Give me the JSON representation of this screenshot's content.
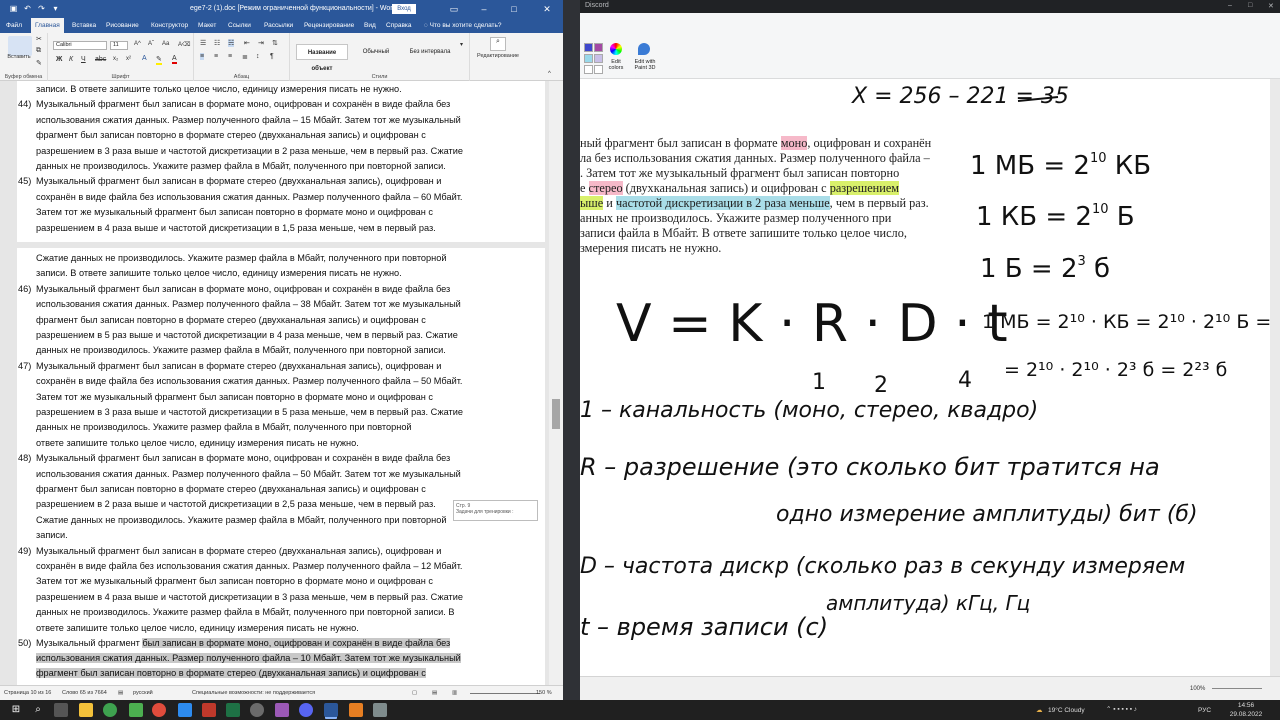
{
  "word": {
    "title": "ege7-2 (1).doc [Режим ограниченной функциональности] - Word",
    "signin": "Вход",
    "tabs": [
      "Файл",
      "Главная",
      "Вставка",
      "Рисование",
      "Конструктор",
      "Макет",
      "Ссылки",
      "Рассылки",
      "Рецензирование",
      "Вид",
      "Справка"
    ],
    "tell_me": "Что вы хотите сделать?",
    "ribbon": {
      "paste": "Вставить",
      "font_name": "Calibri",
      "font_size": "11",
      "clipboard": "Буфер обмена",
      "font": "Шрифт",
      "paragraph": "Абзац",
      "styles": "Стили",
      "editing": "Редактирование",
      "style_items": [
        "Название объект",
        "Обычный",
        "Без интервала"
      ]
    },
    "doc_lines": [
      {
        "n": "",
        "t": "записи. В ответе запишите только целое число, единицу измерения писать не нужно."
      },
      {
        "n": "44)",
        "t": "Музыкальный фрагмент был записан в формате моно, оцифрован и сохранён в виде файла без"
      },
      {
        "n": "",
        "t": "использования сжатия данных. Размер полученного файла – 15 Мбайт. Затем тот же музыкальный"
      },
      {
        "n": "",
        "t": "фрагмент был записан повторно в формате стерео (двухканальная запись) и оцифрован с"
      },
      {
        "n": "",
        "t": "разрешением в 3 раза выше и частотой дискретизации в 2 раза меньше, чем в первый раз. Сжатие"
      },
      {
        "n": "",
        "t": "данных не производилось. Укажите размер файла в Мбайт, полученного при повторной записи."
      },
      {
        "n": "45)",
        "t": "Музыкальный фрагмент был записан в формате стерео (двухканальная запись), оцифрован и"
      },
      {
        "n": "",
        "t": "сохранён в виде файла без использования сжатия данных. Размер полученного файла – 60 Мбайт."
      },
      {
        "n": "",
        "t": "Затем тот же музыкальный фрагмент был записан повторно в формате моно и оцифрован с"
      },
      {
        "n": "",
        "t": "разрешением в 4 раза выше и частотой дискретизации в 1,5 раза меньше, чем в первый раз."
      }
    ],
    "doc_lines2": [
      {
        "n": "",
        "t": "Сжатие данных не производилось. Укажите размер файла в Мбайт, полученного при повторной"
      },
      {
        "n": "",
        "t": "записи. В ответе запишите только целое число, единицу измерения писать не нужно."
      },
      {
        "n": "46)",
        "t": "Музыкальный фрагмент был записан в формате моно, оцифрован и сохранён в виде файла без"
      },
      {
        "n": "",
        "t": "использования сжатия данных. Размер полученного файла – 38 Мбайт. Затем тот же музыкальный"
      },
      {
        "n": "",
        "t": "фрагмент был записан повторно в формате стерео (двухканальная запись) и оцифрован с"
      },
      {
        "n": "",
        "t": "разрешением в 5 раз выше и частотой дискретизации в 4 раза меньше, чем в первый раз. Сжатие"
      },
      {
        "n": "",
        "t": "данных не производилось. Укажите размер файла в Мбайт, полученного при повторной записи."
      },
      {
        "n": "47)",
        "t": "Музыкальный фрагмент был записан в формате стерео (двухканальная запись), оцифрован и"
      },
      {
        "n": "",
        "t": "сохранён в виде файла без использования сжатия данных. Размер полученного файла – 50 Мбайт."
      },
      {
        "n": "",
        "t": "Затем тот же музыкальный фрагмент был записан повторно в формате моно и оцифрован с"
      },
      {
        "n": "",
        "t": "разрешением в 3 раза выше и частотой дискретизации в 5 раза меньше, чем в первый раз. Сжатие"
      },
      {
        "n": "",
        "t": "данных не производилось. Укажите размер файла в Мбайт, полученного при повторной"
      },
      {
        "n": "",
        "t": "ответе запишите только целое число, единицу измерения писать не нужно."
      },
      {
        "n": "48)",
        "t": "Музыкальный фрагмент был записан в формате моно, оцифрован и сохранён в виде файла без"
      },
      {
        "n": "",
        "t": "использования сжатия данных. Размер полученного файла – 50 Мбайт. Затем тот же музыкальный"
      },
      {
        "n": "",
        "t": "фрагмент был записан повторно в формате стерео (двухканальная запись) и оцифрован с"
      },
      {
        "n": "",
        "t": "разрешением в 2 раза выше и частотой дискретизации в 2,5 раза меньше, чем в первый раз."
      },
      {
        "n": "",
        "t": "Сжатие данных не производилось. Укажите размер файла в Мбайт, полученного при повторной"
      },
      {
        "n": "",
        "t": "записи."
      },
      {
        "n": "49)",
        "t": "Музыкальный фрагмент был записан в формате стерео (двухканальная запись), оцифрован и"
      },
      {
        "n": "",
        "t": "сохранён в виде файла без использования сжатия данных. Размер полученного файла – 12 Мбайт."
      },
      {
        "n": "",
        "t": "Затем тот же музыкальный фрагмент был записан повторно в формате моно и оцифрован с"
      },
      {
        "n": "",
        "t": "разрешением в 4 раза выше и частотой дискретизации в 3 раза меньше, чем в первый раз. Сжатие"
      },
      {
        "n": "",
        "t": "данных не производилось. Укажите размер файла в Мбайт, полученного при повторной записи. В"
      },
      {
        "n": "",
        "t": "ответе запишите только целое число, единицу измерения писать не нужно."
      }
    ],
    "last_item": {
      "n": "50)",
      "l1a": "Музыкальный фрагмент ",
      "l1b": "был записан в формате моно, оцифрован и сохранён в виде файла без",
      "l2": "использования сжатия данных. Размер полученного файла – 10 Мбайт. Затем тот же музыкальный",
      "l3": "фрагмент был записан повторно в формате стерео (двухканальная запись) и оцифрован с"
    },
    "tooltip": {
      "page": "Стр. 9",
      "text": "Задачи для тренировки :"
    },
    "status": {
      "page": "Страница 10 из 16",
      "words": "Слово 65 из 7664",
      "lang": "русский",
      "access": "Специальные возможности: не поддерживается",
      "zoom": "150 %"
    }
  },
  "paint": {
    "discord_title": "Discord",
    "edit_colors": "Edit colors",
    "edit_paint3d": "Edit with Paint 3D",
    "pasted_text": {
      "l1a": "ный фрагмент был записан в формате ",
      "l1b": "моно",
      "l1c": ", оцифрован и сохранён",
      "l2": "ла без использования сжатия данных. Размер полученного файла –",
      "l3": ". Затем тот же музыкальный фрагмент был записан повторно",
      "l4a": "е ",
      "l4b": "стерео",
      "l4c": " (двухканальная запись) и оцифрован с ",
      "l4d": "разрешением",
      "l5a": "ыше",
      "l5b": " и ",
      "l5c": "частотой дискретизации в 2 раза меньше",
      "l5d": ", чем в первый раз.",
      "l6": "анных не производилось. Укажите размер полученного при",
      "l7": " записи файла в Мбайт. В ответе запишите только целое число,",
      "l8": "змерения писать не нужно."
    },
    "handwriting": {
      "top_eq": "X = 256 – 221 = 35",
      "formula": "V = K · R · D · t",
      "mb": "1 МБ = 2",
      "mb_exp": "10",
      "mb_unit": " КБ",
      "kb": "1 КБ = 2",
      "kb_exp": "10",
      "kb_unit": " Б",
      "b": "1 Б = 2",
      "b_exp": "3",
      "b_unit": " б",
      "long1": "1 МБ = 2¹⁰ · КБ = 2¹⁰ · 2¹⁰ Б =",
      "long2": "= 2¹⁰ · 2¹⁰ · 2³ б = 2²³ б",
      "nums": [
        "1",
        "2",
        "4"
      ],
      "k_line": "1 – канальность (моно, стерео, квадро)",
      "r_line": "R – разрешение (это сколько бит тратится на",
      "r_line2": "одно измерение амплитуды) бит (б)",
      "d_line": "D – частота дискр (сколько раз в секунду измеряем",
      "d_line2": "амплитуда) кГц, Гц",
      "t_line": "t – время записи (с)"
    },
    "zoom": "100%"
  },
  "taskbar": {
    "weather": "19°C  Cloudy",
    "lang": "РУС",
    "time": "14:56",
    "date": "29.08.2022"
  }
}
